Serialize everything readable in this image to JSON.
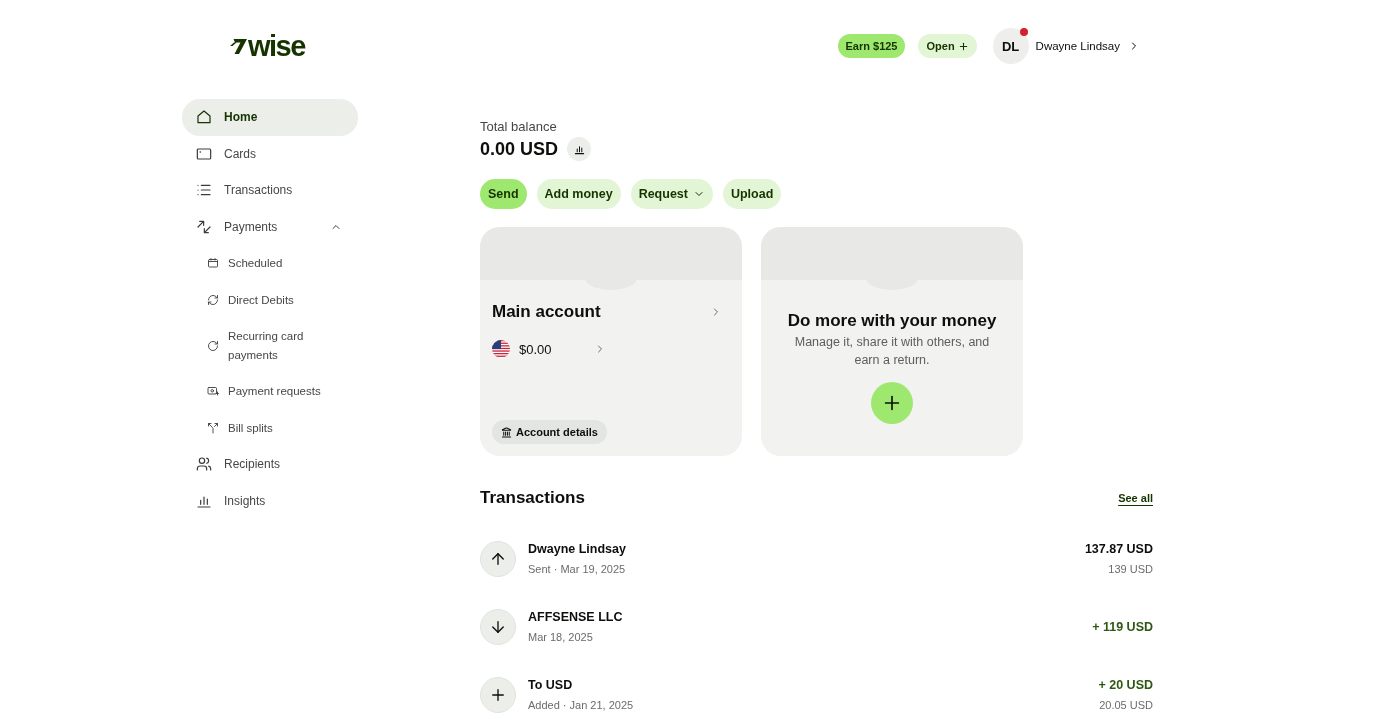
{
  "logo": {
    "wordmark": "wise"
  },
  "header": {
    "earn_button": "Earn $125",
    "open_button": "Open",
    "avatar": {
      "initials": "DL",
      "notification": true
    },
    "user_name": "Dwayne Lindsay"
  },
  "sidebar": {
    "items": [
      {
        "label": "Home",
        "selected": true
      },
      {
        "label": "Cards",
        "selected": false
      },
      {
        "label": "Transactions",
        "selected": false
      },
      {
        "label": "Payments",
        "selected": false,
        "expanded": true,
        "children": [
          {
            "label": "Scheduled",
            "selected": false
          },
          {
            "label": "Direct Debits",
            "selected": false
          },
          {
            "label": "Recurring card payments",
            "selected": false
          },
          {
            "label": "Payment requests",
            "selected": false
          },
          {
            "label": "Bill splits",
            "selected": false
          }
        ]
      },
      {
        "label": "Recipients",
        "selected": false
      },
      {
        "label": "Insights",
        "selected": false
      }
    ]
  },
  "balance": {
    "label": "Total balance",
    "amount": "0.00 USD"
  },
  "actions": [
    {
      "label": "Send",
      "primary": true,
      "menu": false
    },
    {
      "label": "Add money",
      "primary": false,
      "menu": false
    },
    {
      "label": "Request",
      "primary": false,
      "menu": true
    },
    {
      "label": "Upload",
      "primary": false,
      "menu": false
    }
  ],
  "account_card": {
    "title": "Main account",
    "balances": [
      {
        "amount": "$0.00"
      }
    ],
    "details_button": "Account details"
  },
  "promo_card": {
    "title": "Do more with your money",
    "text": "Manage it, share it with others, and earn a return."
  },
  "transactions": {
    "title": "Transactions",
    "see_all": "See all",
    "rows": [
      {
        "kind": "sent",
        "name": "Dwayne Lindsay",
        "detail": "Sent · Mar 19, 2025",
        "amount": "137.87 USD",
        "secondary_amount": "139 USD"
      },
      {
        "kind": "received",
        "name": "AFFSENSE LLC",
        "detail": "Mar 18, 2025",
        "amount": "+ 119 USD"
      },
      {
        "kind": "added",
        "name": "To USD",
        "detail": "Added · Jan 21, 2025",
        "amount": "+ 20 USD",
        "secondary_amount": "20.05 USD"
      }
    ]
  }
}
